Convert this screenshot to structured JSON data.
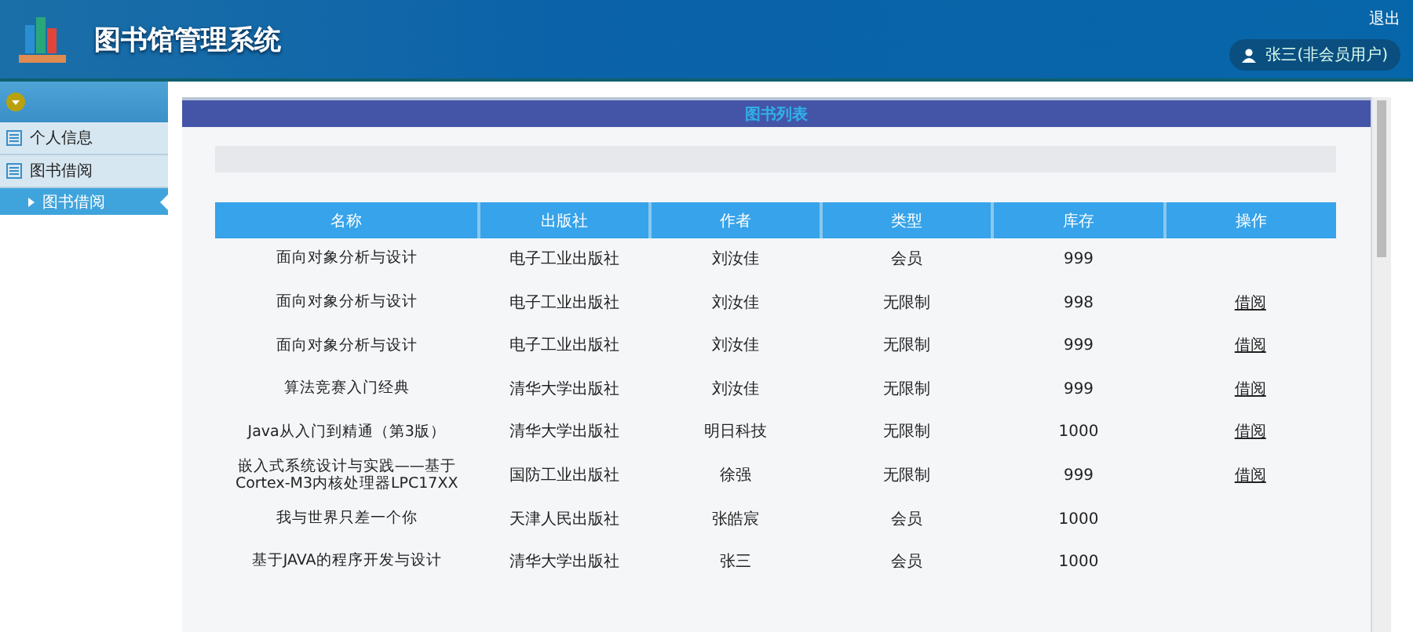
{
  "header": {
    "title": "图书馆管理系统",
    "logout": "退出",
    "user": "张三(非会员用户)"
  },
  "sidebar": {
    "items": [
      {
        "label": "个人信息"
      },
      {
        "label": "图书借阅",
        "children": [
          {
            "label": "图书借阅",
            "selected": true
          }
        ]
      }
    ]
  },
  "panel": {
    "title": "图书列表"
  },
  "table": {
    "columns": [
      "名称",
      "出版社",
      "作者",
      "类型",
      "库存",
      "操作"
    ],
    "rows": [
      {
        "cells": [
          "面向对象分析与设计",
          "电子工业出版社",
          "刘汝佳",
          "会员",
          "999"
        ]
      },
      {
        "cells": [
          "面向对象分析与设计",
          "电子工业出版社",
          "刘汝佳",
          "无限制",
          "998"
        ],
        "action": "借阅"
      },
      {
        "cells": [
          "面向对象分析与设计",
          "电子工业出版社",
          "刘汝佳",
          "无限制",
          "999"
        ],
        "action": "借阅"
      },
      {
        "cells": [
          "算法竞赛入门经典",
          "清华大学出版社",
          "刘汝佳",
          "无限制",
          "999"
        ],
        "action": "借阅"
      },
      {
        "cells": [
          "Java从入门到精通（第3版）",
          "清华大学出版社",
          "明日科技",
          "无限制",
          "1000"
        ],
        "action": "借阅"
      },
      {
        "cells": [
          "嵌入式系统设计与实践——基于Cortex-M3内核处理器LPC17XX",
          "国防工业出版社",
          "徐强",
          "无限制",
          "999"
        ],
        "action": "借阅"
      },
      {
        "cells": [
          "我与世界只差一个你",
          "天津人民出版社",
          "张皓宸",
          "会员",
          "1000"
        ]
      },
      {
        "cells": [
          "基于JAVA的程序开发与设计",
          "清华大学出版社",
          "张三",
          "会员",
          "1000"
        ]
      }
    ]
  }
}
